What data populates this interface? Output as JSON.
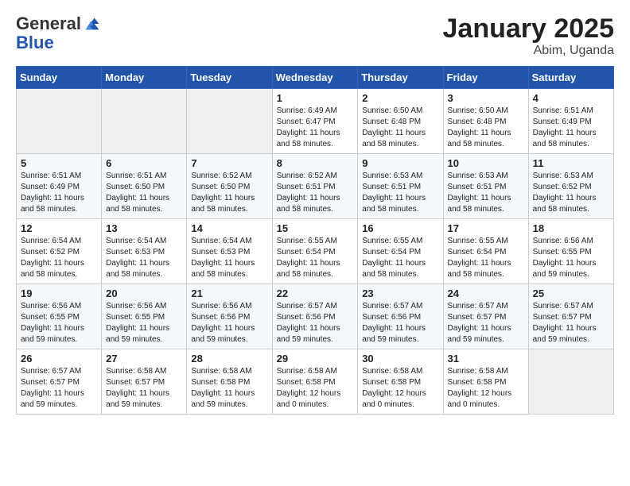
{
  "header": {
    "logo_line1": "General",
    "logo_line2": "Blue",
    "title": "January 2025",
    "subtitle": "Abim, Uganda"
  },
  "weekdays": [
    "Sunday",
    "Monday",
    "Tuesday",
    "Wednesday",
    "Thursday",
    "Friday",
    "Saturday"
  ],
  "weeks": [
    [
      {
        "day": "",
        "info": ""
      },
      {
        "day": "",
        "info": ""
      },
      {
        "day": "",
        "info": ""
      },
      {
        "day": "1",
        "info": "Sunrise: 6:49 AM\nSunset: 6:47 PM\nDaylight: 11 hours and 58 minutes."
      },
      {
        "day": "2",
        "info": "Sunrise: 6:50 AM\nSunset: 6:48 PM\nDaylight: 11 hours and 58 minutes."
      },
      {
        "day": "3",
        "info": "Sunrise: 6:50 AM\nSunset: 6:48 PM\nDaylight: 11 hours and 58 minutes."
      },
      {
        "day": "4",
        "info": "Sunrise: 6:51 AM\nSunset: 6:49 PM\nDaylight: 11 hours and 58 minutes."
      }
    ],
    [
      {
        "day": "5",
        "info": "Sunrise: 6:51 AM\nSunset: 6:49 PM\nDaylight: 11 hours and 58 minutes."
      },
      {
        "day": "6",
        "info": "Sunrise: 6:51 AM\nSunset: 6:50 PM\nDaylight: 11 hours and 58 minutes."
      },
      {
        "day": "7",
        "info": "Sunrise: 6:52 AM\nSunset: 6:50 PM\nDaylight: 11 hours and 58 minutes."
      },
      {
        "day": "8",
        "info": "Sunrise: 6:52 AM\nSunset: 6:51 PM\nDaylight: 11 hours and 58 minutes."
      },
      {
        "day": "9",
        "info": "Sunrise: 6:53 AM\nSunset: 6:51 PM\nDaylight: 11 hours and 58 minutes."
      },
      {
        "day": "10",
        "info": "Sunrise: 6:53 AM\nSunset: 6:51 PM\nDaylight: 11 hours and 58 minutes."
      },
      {
        "day": "11",
        "info": "Sunrise: 6:53 AM\nSunset: 6:52 PM\nDaylight: 11 hours and 58 minutes."
      }
    ],
    [
      {
        "day": "12",
        "info": "Sunrise: 6:54 AM\nSunset: 6:52 PM\nDaylight: 11 hours and 58 minutes."
      },
      {
        "day": "13",
        "info": "Sunrise: 6:54 AM\nSunset: 6:53 PM\nDaylight: 11 hours and 58 minutes."
      },
      {
        "day": "14",
        "info": "Sunrise: 6:54 AM\nSunset: 6:53 PM\nDaylight: 11 hours and 58 minutes."
      },
      {
        "day": "15",
        "info": "Sunrise: 6:55 AM\nSunset: 6:54 PM\nDaylight: 11 hours and 58 minutes."
      },
      {
        "day": "16",
        "info": "Sunrise: 6:55 AM\nSunset: 6:54 PM\nDaylight: 11 hours and 58 minutes."
      },
      {
        "day": "17",
        "info": "Sunrise: 6:55 AM\nSunset: 6:54 PM\nDaylight: 11 hours and 58 minutes."
      },
      {
        "day": "18",
        "info": "Sunrise: 6:56 AM\nSunset: 6:55 PM\nDaylight: 11 hours and 59 minutes."
      }
    ],
    [
      {
        "day": "19",
        "info": "Sunrise: 6:56 AM\nSunset: 6:55 PM\nDaylight: 11 hours and 59 minutes."
      },
      {
        "day": "20",
        "info": "Sunrise: 6:56 AM\nSunset: 6:55 PM\nDaylight: 11 hours and 59 minutes."
      },
      {
        "day": "21",
        "info": "Sunrise: 6:56 AM\nSunset: 6:56 PM\nDaylight: 11 hours and 59 minutes."
      },
      {
        "day": "22",
        "info": "Sunrise: 6:57 AM\nSunset: 6:56 PM\nDaylight: 11 hours and 59 minutes."
      },
      {
        "day": "23",
        "info": "Sunrise: 6:57 AM\nSunset: 6:56 PM\nDaylight: 11 hours and 59 minutes."
      },
      {
        "day": "24",
        "info": "Sunrise: 6:57 AM\nSunset: 6:57 PM\nDaylight: 11 hours and 59 minutes."
      },
      {
        "day": "25",
        "info": "Sunrise: 6:57 AM\nSunset: 6:57 PM\nDaylight: 11 hours and 59 minutes."
      }
    ],
    [
      {
        "day": "26",
        "info": "Sunrise: 6:57 AM\nSunset: 6:57 PM\nDaylight: 11 hours and 59 minutes."
      },
      {
        "day": "27",
        "info": "Sunrise: 6:58 AM\nSunset: 6:57 PM\nDaylight: 11 hours and 59 minutes."
      },
      {
        "day": "28",
        "info": "Sunrise: 6:58 AM\nSunset: 6:58 PM\nDaylight: 11 hours and 59 minutes."
      },
      {
        "day": "29",
        "info": "Sunrise: 6:58 AM\nSunset: 6:58 PM\nDaylight: 12 hours and 0 minutes."
      },
      {
        "day": "30",
        "info": "Sunrise: 6:58 AM\nSunset: 6:58 PM\nDaylight: 12 hours and 0 minutes."
      },
      {
        "day": "31",
        "info": "Sunrise: 6:58 AM\nSunset: 6:58 PM\nDaylight: 12 hours and 0 minutes."
      },
      {
        "day": "",
        "info": ""
      }
    ]
  ]
}
